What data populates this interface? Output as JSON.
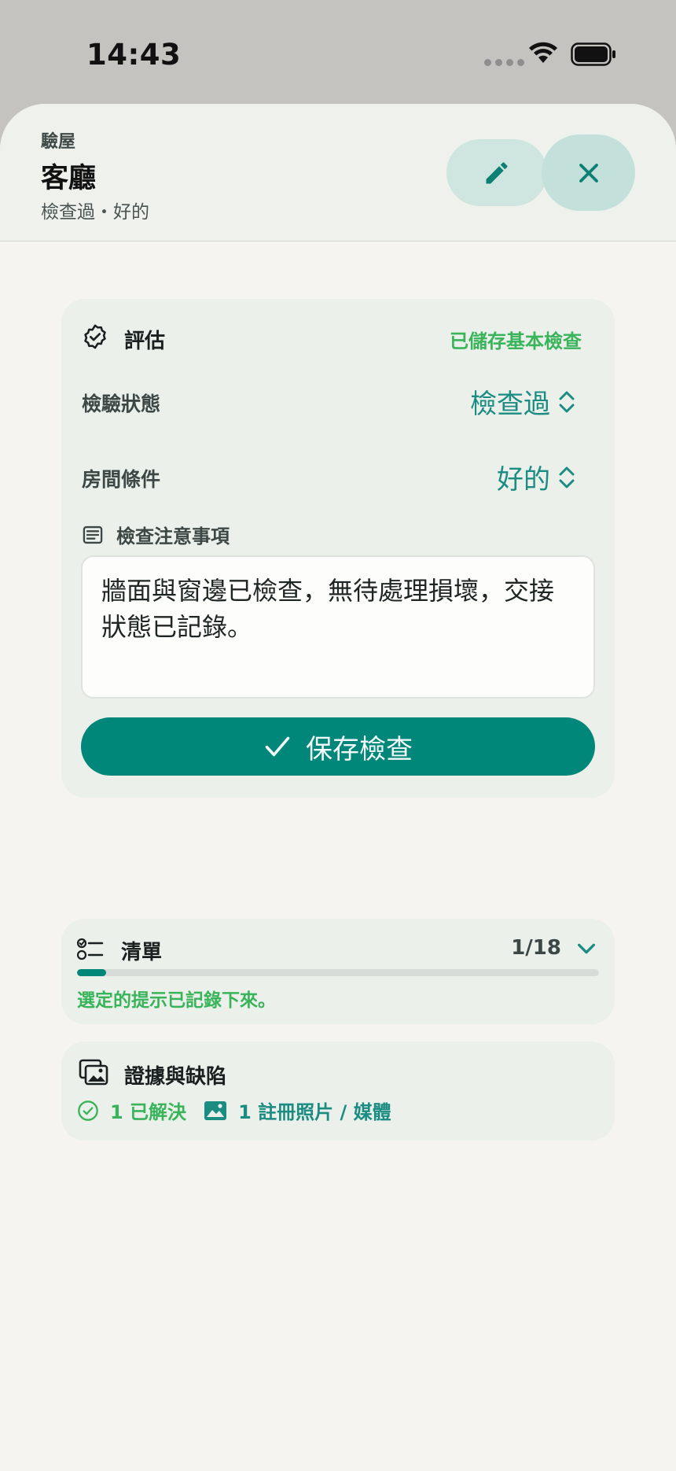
{
  "status_bar": {
    "time": "14:43"
  },
  "header": {
    "overline": "驗屋",
    "title": "客廳",
    "subtitle": "檢查過・好的"
  },
  "assessment": {
    "title": "評估",
    "saved_status": "已儲存基本檢查",
    "rows": [
      {
        "label": "檢驗狀態",
        "value": "檢查過"
      },
      {
        "label": "房間條件",
        "value": "好的"
      }
    ],
    "notes_label": "檢查注意事項",
    "notes_text": "牆面與窗邊已檢查，無待處理損壞，交接狀態已記錄。",
    "save_label": "保存檢查"
  },
  "checklist": {
    "title": "清單",
    "count": "1/18",
    "progress_fraction": 0.0556,
    "note": "選定的提示已記錄下來。"
  },
  "evidence": {
    "title": "證據與缺陷",
    "resolved": "1 已解決",
    "media": "1 註冊照片 / 媒體"
  },
  "colors": {
    "accent": "#00877a",
    "accent_text": "#1a8c82",
    "success": "#3ab45a",
    "card_bg": "#ebf0eb",
    "sheet_bg": "#f5f4f0"
  }
}
